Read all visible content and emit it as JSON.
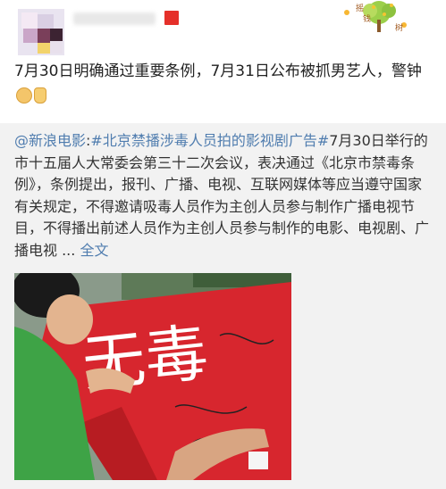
{
  "post": {
    "text": "7月30日明确通过重要条例，7月31日公布被抓男艺人，警钟",
    "emojis": [
      "fist-emoji",
      "thumbs-up-emoji"
    ]
  },
  "header": {
    "badge_color": "#e5302a",
    "tree_logo_text": "摇钱树"
  },
  "repost": {
    "mention": "@新浪电影",
    "hashtag": "#北京禁播涉毒人员拍的影视剧广告#",
    "body": "7月30日举行的市十五届人大常委会第三十二次会议，表决通过《北京市禁毒条例》，条例提出，报刊、广播、电视、互联网媒体等应当遵守国家有关规定，不得邀请吸毒人员作为主创人员参与制作广播电视节目，不得播出前述人员作为主创人员参与制作的电影、电视剧、广播电视 ...",
    "more_label": "全文",
    "link_color": "#507daf"
  },
  "photo": {
    "banner_text": "无毒",
    "banner_color": "#d7262e"
  }
}
